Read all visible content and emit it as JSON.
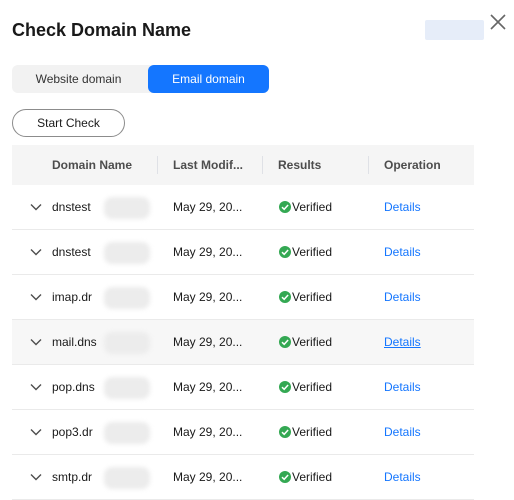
{
  "dialog": {
    "title": "Check Domain Name"
  },
  "tabs": [
    {
      "label": "Website domain",
      "active": false
    },
    {
      "label": "Email domain",
      "active": true
    }
  ],
  "actions": {
    "start_check": "Start Check"
  },
  "table": {
    "columns": [
      "Domain Name",
      "Last Modif...",
      "Results",
      "Operation"
    ],
    "rows": [
      {
        "domain": "dnstest",
        "modified": "May 29, 20...",
        "result": "Verified",
        "operation": "Details"
      },
      {
        "domain": "dnstest",
        "modified": "May 29, 20...",
        "result": "Verified",
        "operation": "Details"
      },
      {
        "domain": "imap.dr",
        "modified": "May 29, 20...",
        "result": "Verified",
        "operation": "Details"
      },
      {
        "domain": "mail.dns",
        "modified": "May 29, 20...",
        "result": "Verified",
        "operation": "Details"
      },
      {
        "domain": "pop.dns",
        "modified": "May 29, 20...",
        "result": "Verified",
        "operation": "Details"
      },
      {
        "domain": "pop3.dr",
        "modified": "May 29, 20...",
        "result": "Verified",
        "operation": "Details"
      },
      {
        "domain": "smtp.dr",
        "modified": "May 29, 20...",
        "result": "Verified",
        "operation": "Details"
      }
    ]
  },
  "colors": {
    "accent": "#1476ff",
    "verified": "#34a853"
  }
}
